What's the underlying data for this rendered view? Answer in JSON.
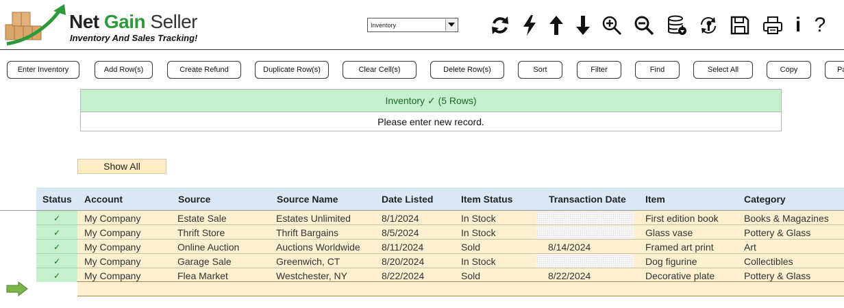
{
  "app": {
    "title_net": "Net",
    "title_gain": "Gain",
    "title_seller": "Seller",
    "subtitle": "Inventory And Sales Tracking!"
  },
  "view_select": {
    "value": "Inventory"
  },
  "toolbar_icons": [
    {
      "name": "refresh-icon"
    },
    {
      "name": "lightning-icon"
    },
    {
      "name": "arrow-up-icon"
    },
    {
      "name": "arrow-down-icon"
    },
    {
      "name": "zoom-in-icon"
    },
    {
      "name": "zoom-out-icon"
    },
    {
      "name": "database-download-icon"
    },
    {
      "name": "sync-key-icon"
    },
    {
      "name": "save-icon"
    },
    {
      "name": "print-icon"
    },
    {
      "name": "info-icon",
      "glyph": "i"
    },
    {
      "name": "help-icon",
      "glyph": "?"
    }
  ],
  "buttons": {
    "enter_inventory": "Enter Inventory",
    "add_rows": "Add Row(s)",
    "create_refund": "Create Refund",
    "duplicate_rows": "Duplicate Row(s)",
    "clear_cells": "Clear Cell(s)",
    "delete_rows": "Delete Row(s)",
    "sort": "Sort",
    "filter": "Filter",
    "find": "Find",
    "select_all": "Select All",
    "copy": "Copy",
    "paste": "Pa"
  },
  "message": {
    "header": "Inventory ✓ (5 Rows)",
    "body": "Please enter new record."
  },
  "show_all": "Show All",
  "table": {
    "columns": [
      "Status",
      "Account",
      "Source",
      "Source Name",
      "Date Listed",
      "Item Status",
      "Transaction Date",
      "Item",
      "Category"
    ],
    "rows": [
      {
        "status": "✓",
        "account": "My Company",
        "source": "Estate Sale",
        "source_name": "Estates Unlimited",
        "date_listed": "8/1/2024",
        "item_status": "In Stock",
        "transaction_date": "",
        "item": "First edition book",
        "category": "Books & Magazines"
      },
      {
        "status": "✓",
        "account": "My Company",
        "source": "Thrift Store",
        "source_name": "Thrift Bargains",
        "date_listed": "8/5/2024",
        "item_status": "In Stock",
        "transaction_date": "",
        "item": "Glass vase",
        "category": "Pottery & Glass"
      },
      {
        "status": "✓",
        "account": "My Company",
        "source": "Online Auction",
        "source_name": "Auctions Worldwide",
        "date_listed": "8/11/2024",
        "item_status": "Sold",
        "transaction_date": "8/14/2024",
        "item": "Framed art print",
        "category": "Art"
      },
      {
        "status": "✓",
        "account": "My Company",
        "source": "Garage Sale",
        "source_name": "Greenwich, CT",
        "date_listed": "8/20/2024",
        "item_status": "In Stock",
        "transaction_date": "",
        "item": "Dog figurine",
        "category": "Collectibles"
      },
      {
        "status": "✓",
        "account": "My Company",
        "source": "Flea Market",
        "source_name": "Westchester, NY",
        "date_listed": "8/22/2024",
        "item_status": "Sold",
        "transaction_date": "8/22/2024",
        "item": "Decorative plate",
        "category": "Pottery & Glass"
      }
    ]
  },
  "colors": {
    "brand_green": "#2c9a3c",
    "header_bg": "#dae8f5",
    "status_bg": "#c6efce",
    "row_bg": "#fdf0d0"
  }
}
